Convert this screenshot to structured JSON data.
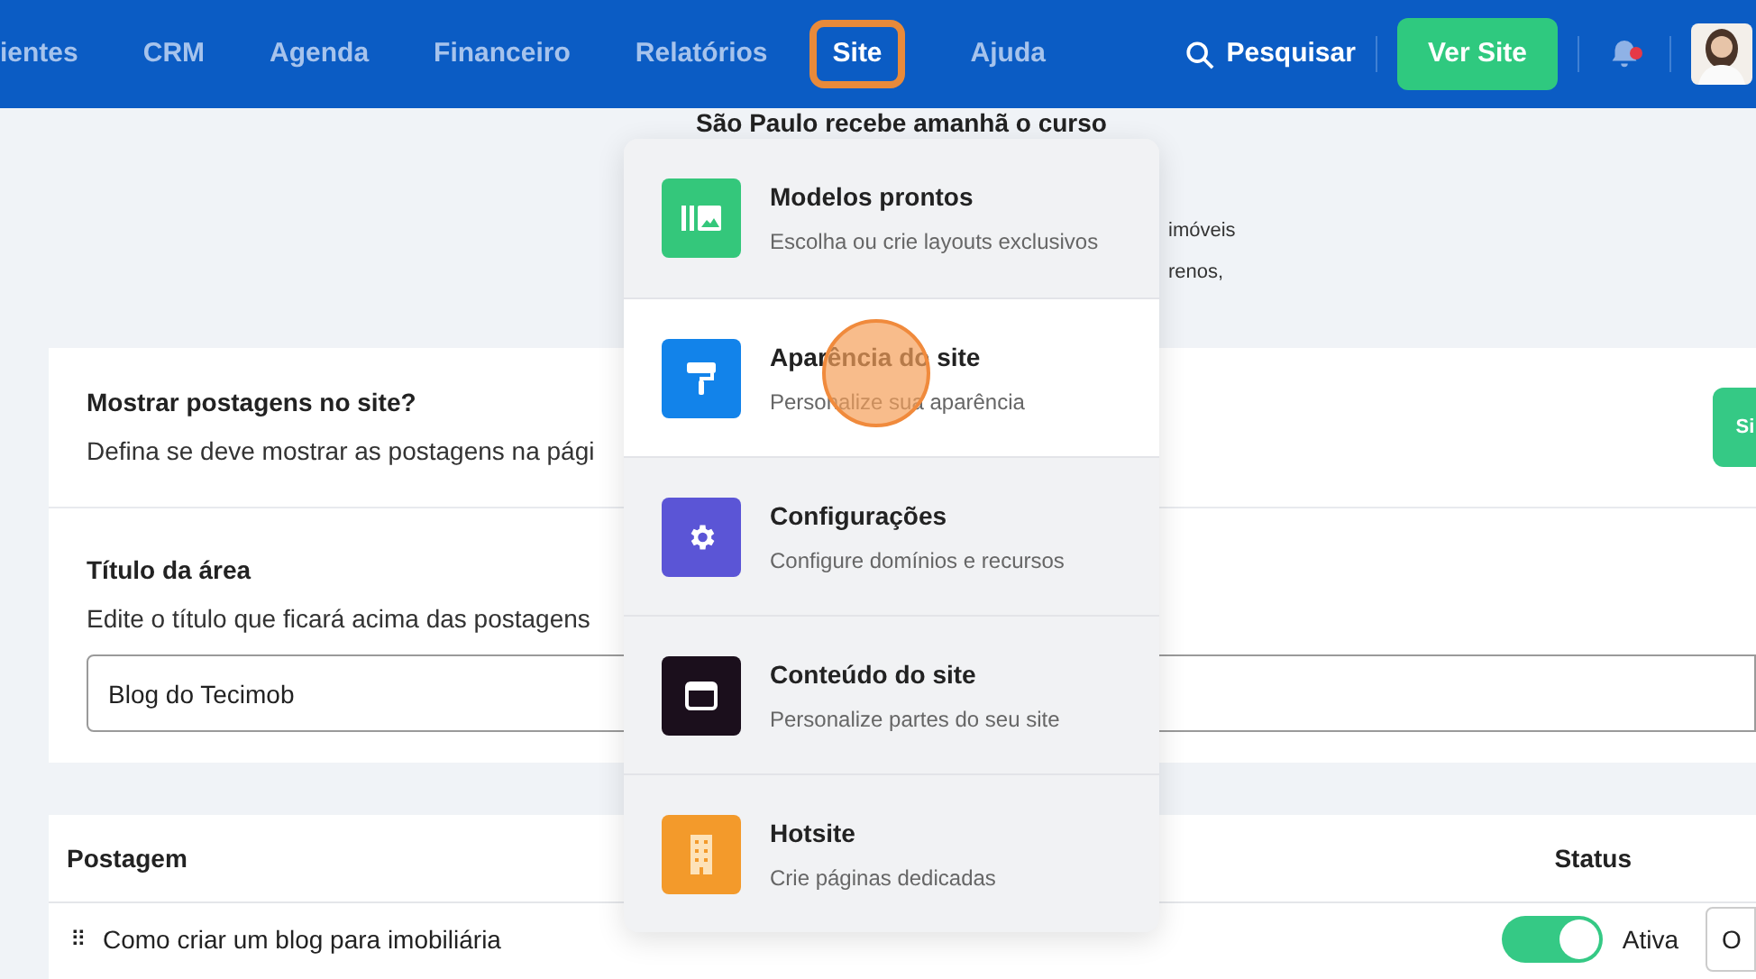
{
  "nav": {
    "items": [
      {
        "label": "ientes",
        "selected": false
      },
      {
        "label": "CRM",
        "selected": false
      },
      {
        "label": "Agenda",
        "selected": false
      },
      {
        "label": "Financeiro",
        "selected": false
      },
      {
        "label": "Relatórios",
        "selected": false
      },
      {
        "label": "Site",
        "selected": true
      },
      {
        "label": "Ajuda",
        "selected": false
      }
    ],
    "search": "Pesquisar",
    "view_site": "Ver Site",
    "unread_notifications": true
  },
  "banner": {
    "title": "São Paulo recebe amanhã o curso",
    "fragments": [
      "imóveis",
      "renos,"
    ]
  },
  "site_menu": {
    "items": [
      {
        "kind": "templates",
        "title": "Modelos prontos",
        "subtitle": "Escolha ou crie layouts exclusivos",
        "color": "#34c77b",
        "selected": false
      },
      {
        "kind": "appearance",
        "title": "Aparência do site",
        "subtitle": "Personalize sua aparência",
        "color": "#1283ea",
        "selected": true
      },
      {
        "kind": "settings",
        "title": "Configurações",
        "subtitle": "Configure domínios e recursos",
        "color": "#5b55d6",
        "selected": false
      },
      {
        "kind": "content",
        "title": "Conteúdo do site",
        "subtitle": "Personalize partes do seu site",
        "color": "#1b0f1c",
        "selected": false
      },
      {
        "kind": "hotsite",
        "title": "Hotsite",
        "subtitle": "Crie páginas dedicadas",
        "color": "#f39a2b",
        "selected": false
      }
    ],
    "click_highlight": true
  },
  "settings": {
    "show_posts": {
      "title": "Mostrar postagens no site?",
      "description": "Defina se deve mostrar as postagens na pági",
      "button": "Si"
    },
    "area_title": {
      "title": "Título da área",
      "description": "Edite o título que ficará acima das postagens",
      "value": "Blog do Tecimob"
    }
  },
  "posts": {
    "columns": [
      "Postagem",
      "Status"
    ],
    "rows": [
      {
        "handle": "⠿",
        "title": "Como criar um blog para imobiliária",
        "active": true,
        "status": "Ativa",
        "column_3": "O"
      }
    ]
  }
}
